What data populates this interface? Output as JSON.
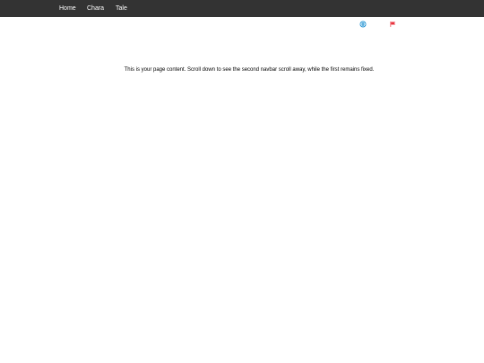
{
  "navbar": {
    "items": [
      {
        "label": "Home"
      },
      {
        "label": "Chara"
      },
      {
        "label": "Tale"
      }
    ]
  },
  "icons": {
    "globe": "globe-icon",
    "flag": "flag-icon"
  },
  "colors": {
    "navbar_bg": "#333333",
    "nav_text": "#ffffff",
    "globe_icon": "#1a8fd1",
    "flag_icon": "#e8323c"
  },
  "main": {
    "text": "This is your page content. Scroll down to see the second navbar scroll away, while the first remains fixed."
  }
}
